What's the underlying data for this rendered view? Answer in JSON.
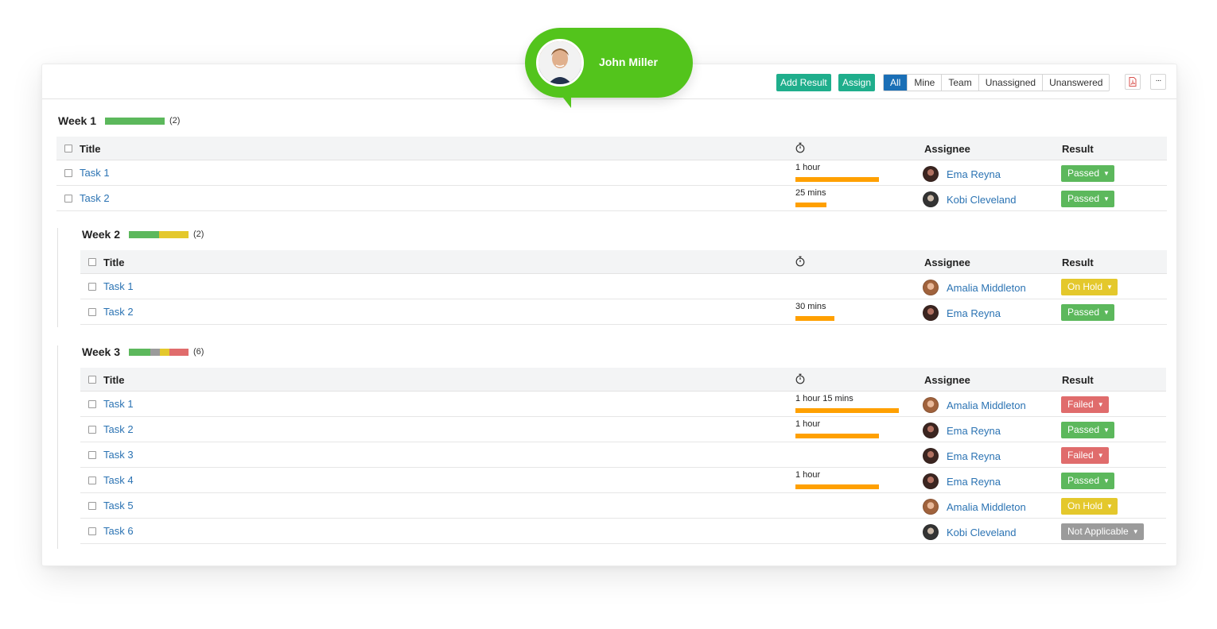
{
  "toolbar": {
    "add_result": "Add Result",
    "assign": "Assign",
    "filters": [
      {
        "label": "All",
        "active": true
      },
      {
        "label": "Mine",
        "active": false
      },
      {
        "label": "Team",
        "active": false
      },
      {
        "label": "Unassigned",
        "active": false
      },
      {
        "label": "Unanswered",
        "active": false
      }
    ],
    "pdf_icon": "pdf-icon",
    "more_icon": "more-icon",
    "more_label": "···"
  },
  "bubble": {
    "name": "John Miller"
  },
  "columns": {
    "title": "Title",
    "assignee": "Assignee",
    "result": "Result",
    "time_icon": "stopwatch-icon"
  },
  "colors": {
    "passed": "#5cb85c",
    "on_hold": "#e4c82c",
    "failed": "#e06c6c",
    "not_applicable": "#9b9b9b",
    "estimate": "#ffa000",
    "link": "#2b73b3",
    "accent": "#1a6fb6"
  },
  "weeks": [
    {
      "title": "Week 1",
      "count": "(2)",
      "rows": [
        {
          "title": "Task 1",
          "estimate": "1 hour",
          "est_fraction": 0.81,
          "assignee": "Ema Reyna",
          "result": "Passed"
        },
        {
          "title": "Task 2",
          "estimate": "25 mins",
          "est_fraction": 0.3,
          "assignee": "Kobi Cleveland",
          "result": "Passed"
        }
      ]
    },
    {
      "title": "Week 2",
      "count": "(2)",
      "rows": [
        {
          "title": "Task 1",
          "estimate": "",
          "est_fraction": 0,
          "assignee": "Amalia Middleton",
          "result": "On Hold"
        },
        {
          "title": "Task 2",
          "estimate": "30 mins",
          "est_fraction": 0.38,
          "assignee": "Ema Reyna",
          "result": "Passed"
        }
      ]
    },
    {
      "title": "Week 3",
      "count": "(6)",
      "rows": [
        {
          "title": "Task 1",
          "estimate": "1 hour 15 mins",
          "est_fraction": 1.0,
          "assignee": "Amalia Middleton",
          "result": "Failed"
        },
        {
          "title": "Task 2",
          "estimate": "1 hour",
          "est_fraction": 0.81,
          "assignee": "Ema Reyna",
          "result": "Passed"
        },
        {
          "title": "Task 3",
          "estimate": "",
          "est_fraction": 0,
          "assignee": "Ema Reyna",
          "result": "Failed"
        },
        {
          "title": "Task 4",
          "estimate": "1 hour",
          "est_fraction": 0.81,
          "assignee": "Ema Reyna",
          "result": "Passed"
        },
        {
          "title": "Task 5",
          "estimate": "",
          "est_fraction": 0,
          "assignee": "Amalia Middleton",
          "result": "On Hold"
        },
        {
          "title": "Task 6",
          "estimate": "",
          "est_fraction": 0,
          "assignee": "Kobi Cleveland",
          "result": "Not Applicable"
        }
      ]
    }
  ]
}
